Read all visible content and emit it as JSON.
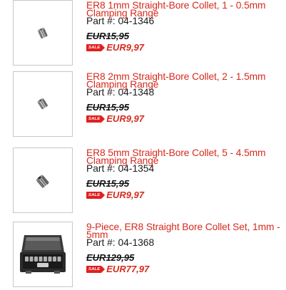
{
  "products": [
    {
      "title": "ER8 1mm Straight-Bore Collet, 1 - 0.5mm Clamping Range",
      "part_label": "Part #:",
      "part_number": "04-1346",
      "old_price": "EUR15,95",
      "sale_badge": "SALE",
      "sale_price": "EUR9,97",
      "image": "collet-icon"
    },
    {
      "title": "ER8 2mm Straight-Bore Collet, 2 - 1.5mm Clamping Range",
      "part_label": "Part #:",
      "part_number": "04-1348",
      "old_price": "EUR15,95",
      "sale_badge": "SALE",
      "sale_price": "EUR9,97",
      "image": "collet-icon"
    },
    {
      "title": "ER8 5mm Straight-Bore Collet, 5 - 4.5mm Clamping Range",
      "part_label": "Part #:",
      "part_number": "04-1354",
      "old_price": "EUR15,95",
      "sale_badge": "SALE",
      "sale_price": "EUR9,97",
      "image": "collet-icon"
    },
    {
      "title": "9-Piece, ER8 Straight Bore Collet Set, 1mm - 5mm",
      "part_label": "Part #:",
      "part_number": "04-1368",
      "old_price": "EUR129,95",
      "sale_badge": "SALE",
      "sale_price": "EUR77,97",
      "image": "collet-set-case-icon"
    }
  ],
  "colors": {
    "title_red": "#d52b1e",
    "sale_badge_red": "#e02020",
    "thumb_border": "#c8c8c8"
  }
}
